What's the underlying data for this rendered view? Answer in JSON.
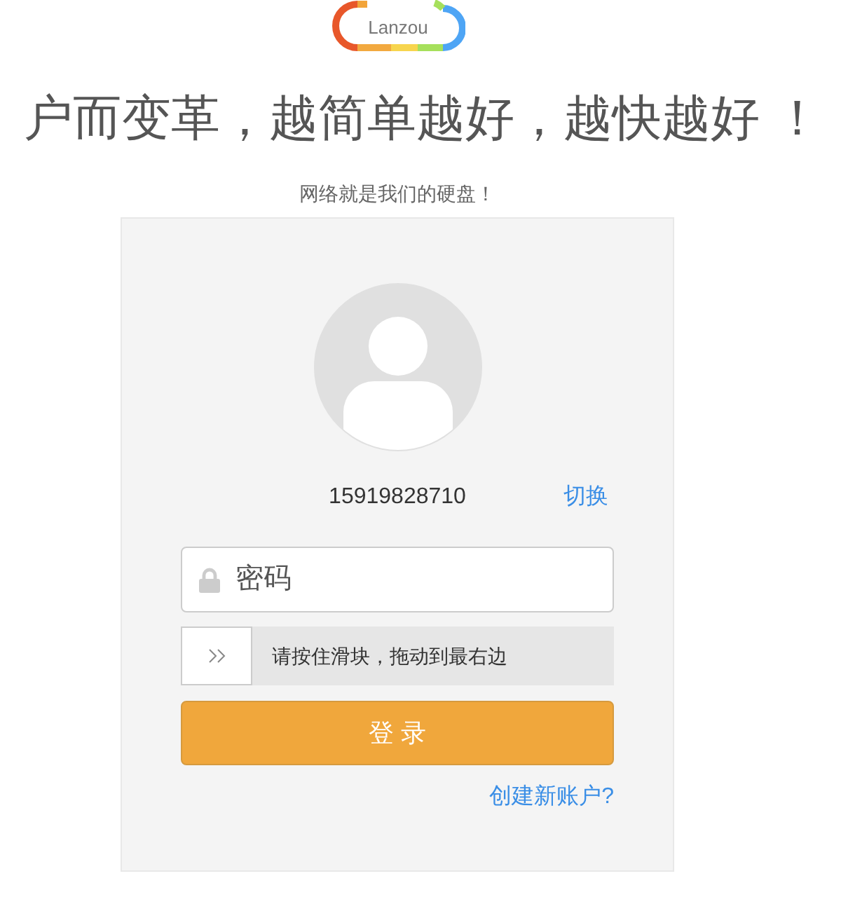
{
  "logo": {
    "text": "Lanzou"
  },
  "headline": "户而变革，越简单越好，越快越好 ！",
  "tagline": "网络就是我们的硬盘！",
  "login_card": {
    "account": "15919828710",
    "switch_link": "切换",
    "password": {
      "placeholder": "密码"
    },
    "slider": {
      "hint": "请按住滑块，拖动到最右边",
      "level": 0
    },
    "login_button": "登 录",
    "register_link": "创建新账户?"
  }
}
